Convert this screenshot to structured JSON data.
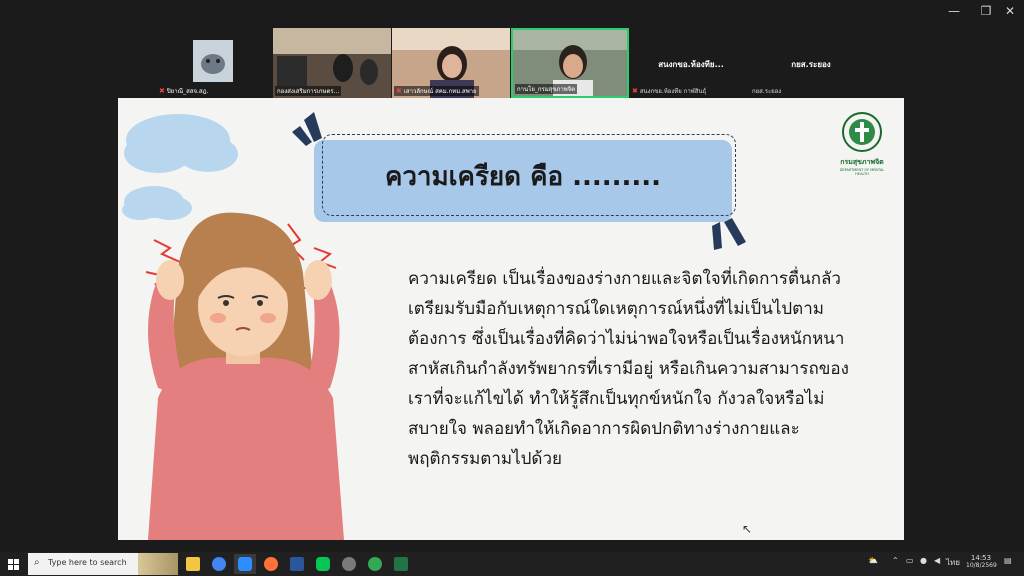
{
  "window": {
    "minimize_icon": "minimize-icon",
    "restore_icon": "restore-icon",
    "close_icon": "close-icon"
  },
  "participants": [
    {
      "name": "ปิยาณี_สสจ.สฎ.",
      "mic": "muted",
      "kind": "photo"
    },
    {
      "name": "กองส่งเสริมการเกษตร...",
      "mic": "on",
      "kind": "video"
    },
    {
      "name": "เสาวลักษณ์ สคม.กทม.สพาย",
      "mic": "muted",
      "kind": "video"
    },
    {
      "name": "กานโย_กรมสุขภาพจิต",
      "mic": "on",
      "kind": "video-active"
    },
    {
      "name": "สนงกขอ.ห้องทีย...",
      "subname": "สนงกขอ.ห้องทีย กาฬสินธุ์",
      "mic": "muted",
      "kind": "name-only"
    },
    {
      "name": "กยส.ระยอง",
      "subname": "กยส.ระยอง",
      "mic": "on",
      "kind": "name-only"
    }
  ],
  "slide": {
    "title": "ความเครียด คือ .........",
    "body": "ความเครียด เป็นเรื่องของร่างกายและจิตใจที่เกิดการตื่นกลัว เตรียมรับมือกับเหตุการณ์ใดเหตุการณ์หนึ่งที่ไม่เป็นไปตามต้องการ ซึ่งเป็นเรื่องที่คิดว่าไม่น่าพอใจหรือเป็นเรื่องหนักหนาสาหัสเกินกำลังทรัพยากรที่เรามีอยู่ หรือเกินความสามารถของเราที่จะแก้ไขได้ ทำให้รู้สึกเป็นทุกข์หนักใจ กังวลใจหรือไม่สบายใจ พลอยทำให้เกิดอาการผิดปกติทางร่างกายและพฤติกรรมตามไปด้วย",
    "logo_title": "กรมสุขภาพจิต",
    "logo_subtitle": "DEPARTMENT OF MENTAL HEALTH"
  },
  "taskbar": {
    "search_placeholder": "Type here to search",
    "apps": [
      "file-explorer-icon",
      "chrome-icon",
      "zoom-icon",
      "firefox-icon",
      "word-icon",
      "line-icon",
      "misc-icon",
      "chrome-icon",
      "excel-icon"
    ],
    "time": "14:53",
    "date": "10/8/2569",
    "lang": "ไทย"
  },
  "colors": {
    "banner": "#a8c8ea",
    "sweater": "#e47f80",
    "hair": "#b8804e",
    "cloud": "#b9d6ef",
    "accent": "#e53935"
  }
}
